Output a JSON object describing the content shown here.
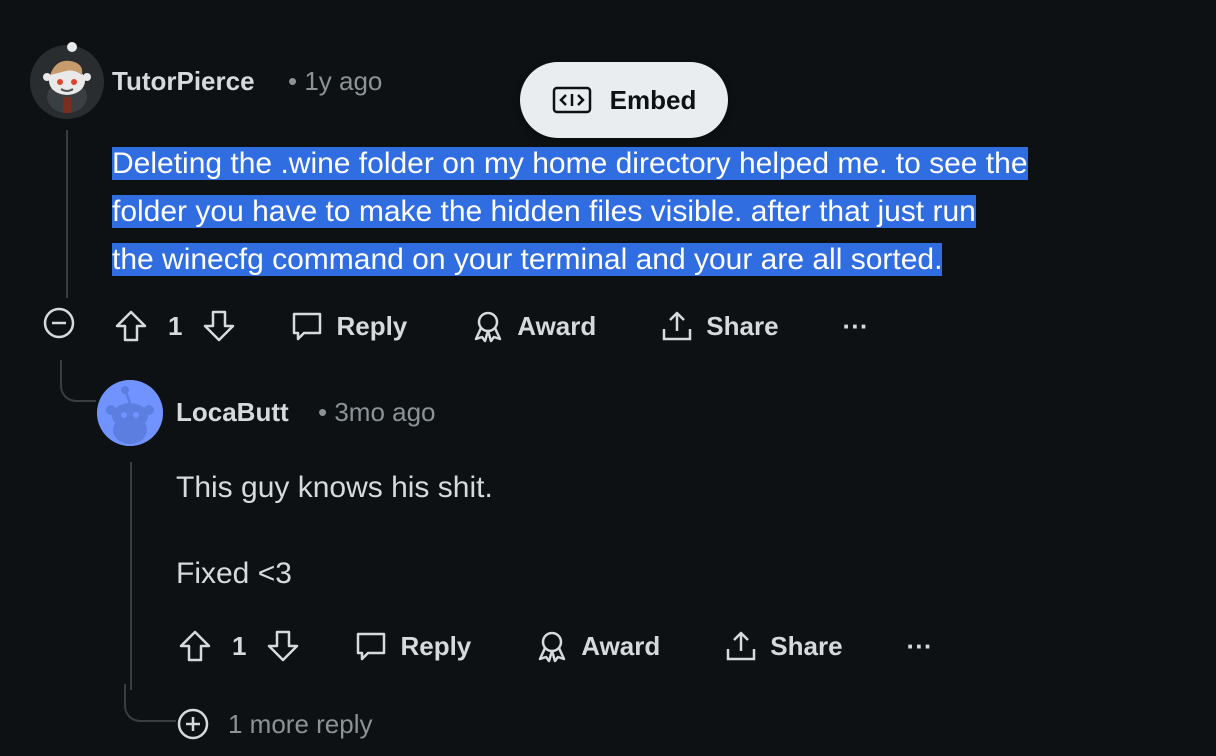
{
  "comments": [
    {
      "username": "TutorPierce",
      "time": "• 1y ago",
      "body_lines": [
        "Deleting the .wine folder on my home directory helped me. to see the",
        "folder you have to make the hidden files visible. after that just run",
        "the winecfg command on your terminal and your are all sorted."
      ],
      "actions": {
        "votes": "1",
        "reply": "Reply",
        "award": "Award",
        "share": "Share",
        "more": "···"
      }
    },
    {
      "username": "LocaButt",
      "time": "• 3mo ago",
      "body_paragraphs": [
        "This guy knows his shit.",
        "Fixed <3"
      ],
      "actions": {
        "votes": "1",
        "reply": "Reply",
        "award": "Award",
        "share": "Share",
        "more": "···"
      }
    }
  ],
  "embed_popup": {
    "label": "Embed",
    "icon": "code-embed-icon"
  },
  "more_replies": "1 more reply",
  "colors": {
    "background": "#0e1113",
    "selection": "#2f6de1",
    "avatar2": "#7193ff",
    "muted": "#8b9397"
  }
}
